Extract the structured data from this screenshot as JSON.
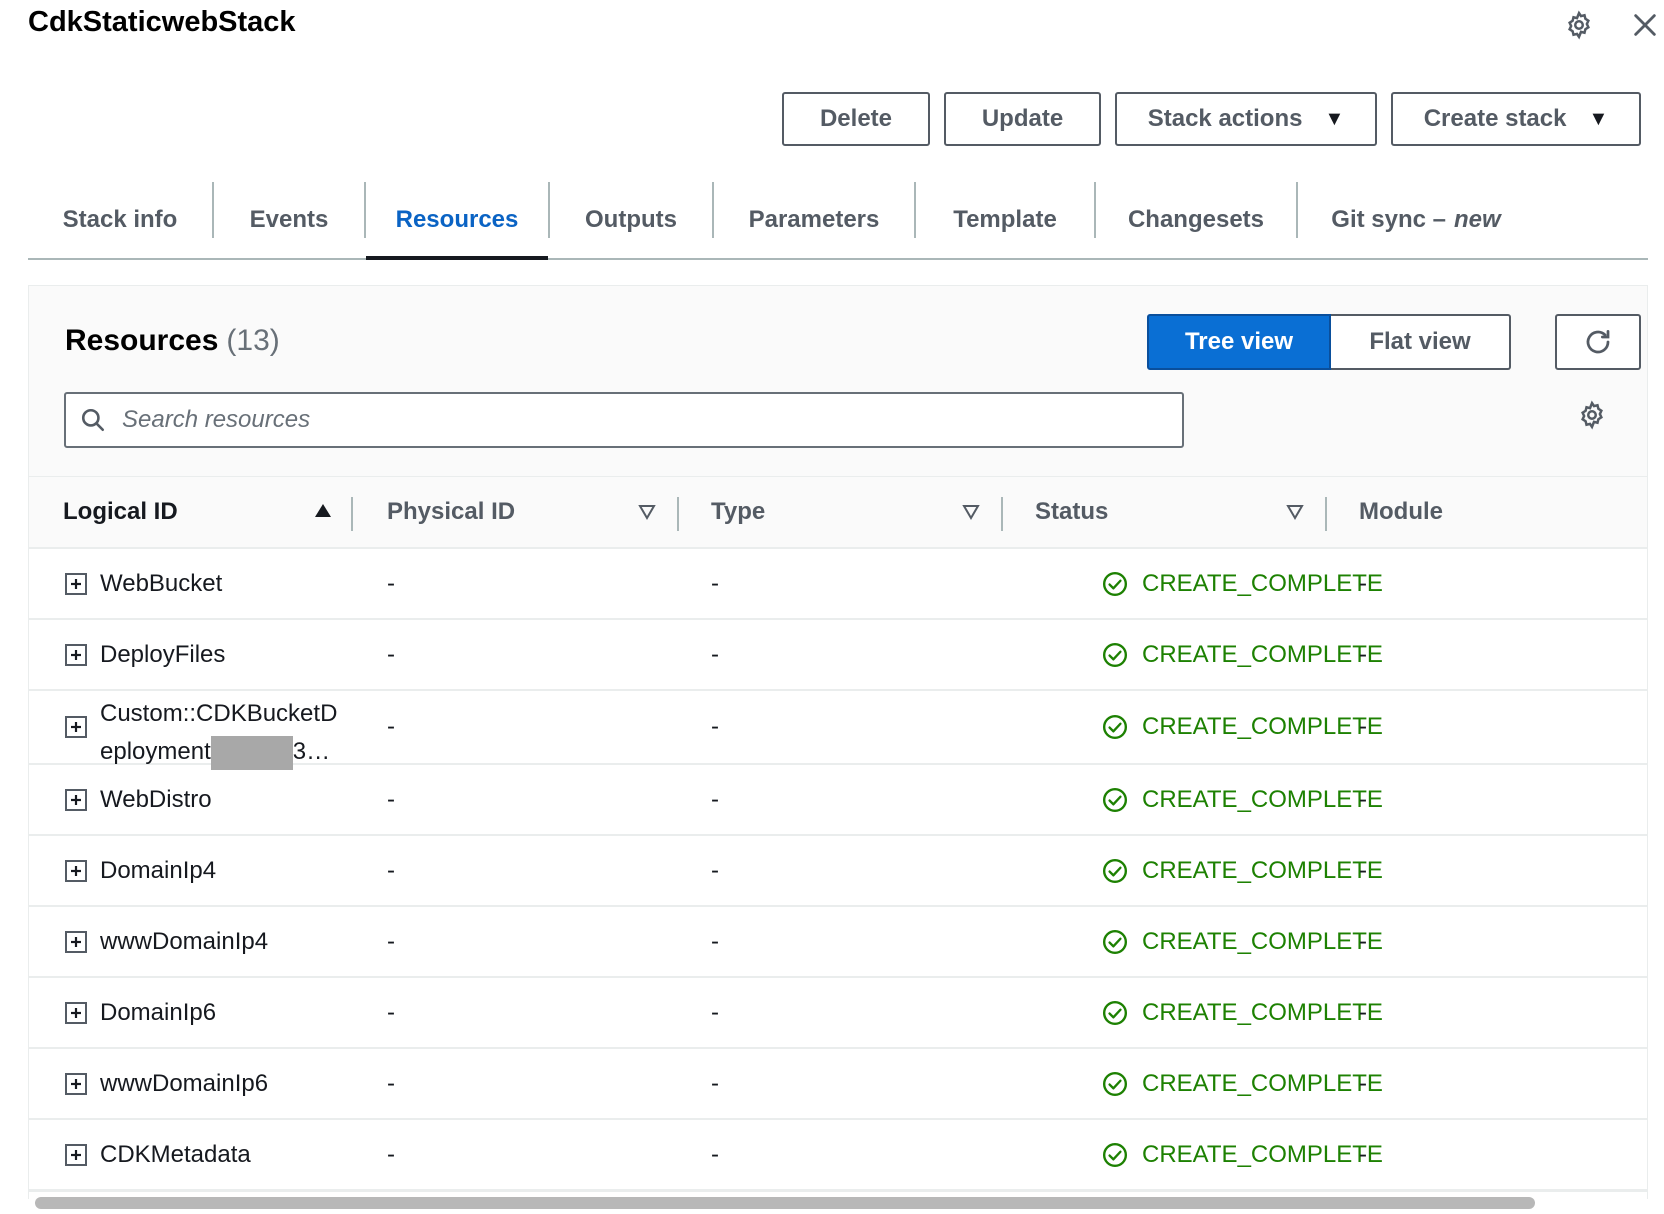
{
  "header": {
    "title": "CdkStaticwebStack"
  },
  "icons": {
    "settings": "gear-icon",
    "close": "close-icon"
  },
  "actions": {
    "delete": "Delete",
    "update": "Update",
    "stack_actions": "Stack actions",
    "create_stack": "Create stack"
  },
  "tabs": [
    {
      "label": "Stack info"
    },
    {
      "label": "Events"
    },
    {
      "label": "Resources"
    },
    {
      "label": "Outputs"
    },
    {
      "label": "Parameters"
    },
    {
      "label": "Template"
    },
    {
      "label": "Changesets"
    },
    {
      "label": "Git sync –",
      "badge": "new"
    }
  ],
  "active_tab": "Resources",
  "resources": {
    "title": "Resources",
    "count": "(13)",
    "view_toggle": {
      "tree": "Tree view",
      "flat": "Flat view",
      "selected": "Tree view"
    },
    "search_placeholder": "Search resources",
    "columns": [
      "Logical ID",
      "Physical ID",
      "Type",
      "Status",
      "Module"
    ],
    "rows": [
      {
        "logical_id": "WebBucket",
        "physical_id": "-",
        "type": "-",
        "status": "CREATE_COMPLETE",
        "module": "-"
      },
      {
        "logical_id": "DeployFiles",
        "physical_id": "-",
        "type": "-",
        "status": "CREATE_COMPLETE",
        "module": "-"
      },
      {
        "logical_id": "Custom::CDKBucketDeployment",
        "logical_id_line1": "Custom::CDKBucketD",
        "logical_id_line2": "eployment",
        "logical_id_tail": "3…",
        "physical_id": "-",
        "type": "-",
        "status": "CREATE_COMPLETE",
        "module": "-"
      },
      {
        "logical_id": "WebDistro",
        "physical_id": "-",
        "type": "-",
        "status": "CREATE_COMPLETE",
        "module": "-"
      },
      {
        "logical_id": "DomainIp4",
        "physical_id": "-",
        "type": "-",
        "status": "CREATE_COMPLETE",
        "module": "-"
      },
      {
        "logical_id": "wwwDomainIp4",
        "physical_id": "-",
        "type": "-",
        "status": "CREATE_COMPLETE",
        "module": "-"
      },
      {
        "logical_id": "DomainIp6",
        "physical_id": "-",
        "type": "-",
        "status": "CREATE_COMPLETE",
        "module": "-"
      },
      {
        "logical_id": "wwwDomainIp6",
        "physical_id": "-",
        "type": "-",
        "status": "CREATE_COMPLETE",
        "module": "-"
      },
      {
        "logical_id": "CDKMetadata",
        "physical_id": "-",
        "type": "-",
        "status": "CREATE_COMPLETE",
        "module": "-"
      }
    ]
  },
  "colors": {
    "accent": "#0a6fd4",
    "success": "#1d8102",
    "text": "#16191f",
    "muted": "#545b64"
  }
}
